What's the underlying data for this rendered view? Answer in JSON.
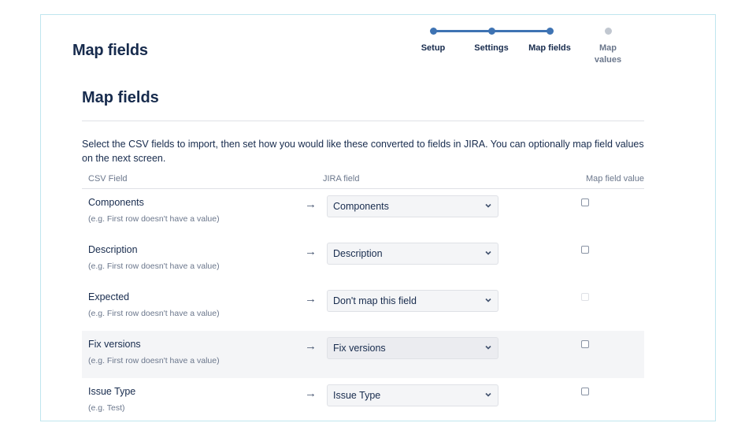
{
  "page": {
    "title": "Map fields"
  },
  "stepper": {
    "steps": [
      {
        "label": "Setup",
        "state": "done"
      },
      {
        "label": "Settings",
        "state": "done"
      },
      {
        "label": "Map fields",
        "state": "current"
      },
      {
        "label": "Map values",
        "state": "pending"
      }
    ],
    "colors": {
      "active": "#3e73b3",
      "pending": "#c1c7d0"
    }
  },
  "section": {
    "title": "Map fields",
    "description": "Select the CSV fields to import, then set how you would like these converted to fields in JIRA. You can optionally map field values on the next screen."
  },
  "table": {
    "headers": {
      "csv": "CSV Field",
      "jira": "JIRA field",
      "map": "Map field value"
    },
    "rows": [
      {
        "field": "Components",
        "example": "(e.g. First row doesn't have a value)",
        "arrow": "→",
        "jira_field": "Components",
        "checked": false,
        "disabled": false,
        "highlighted": false
      },
      {
        "field": "Description",
        "example": "(e.g. First row doesn't have a value)",
        "arrow": "→",
        "jira_field": "Description",
        "checked": false,
        "disabled": false,
        "highlighted": false
      },
      {
        "field": "Expected",
        "example": "(e.g. First row doesn't have a value)",
        "arrow": "→",
        "jira_field": "Don't map this field",
        "checked": false,
        "disabled": true,
        "highlighted": false
      },
      {
        "field": "Fix versions",
        "example": "(e.g. First row doesn't have a value)",
        "arrow": "→",
        "jira_field": "Fix versions",
        "checked": false,
        "disabled": false,
        "highlighted": true
      },
      {
        "field": "Issue Type",
        "example": "(e.g. Test)",
        "arrow": "→",
        "jira_field": "Issue Type",
        "checked": false,
        "disabled": false,
        "highlighted": false
      }
    ]
  },
  "icons": {
    "select_chevron": "chevron-down-icon",
    "arrow": "arrow-right-icon"
  }
}
